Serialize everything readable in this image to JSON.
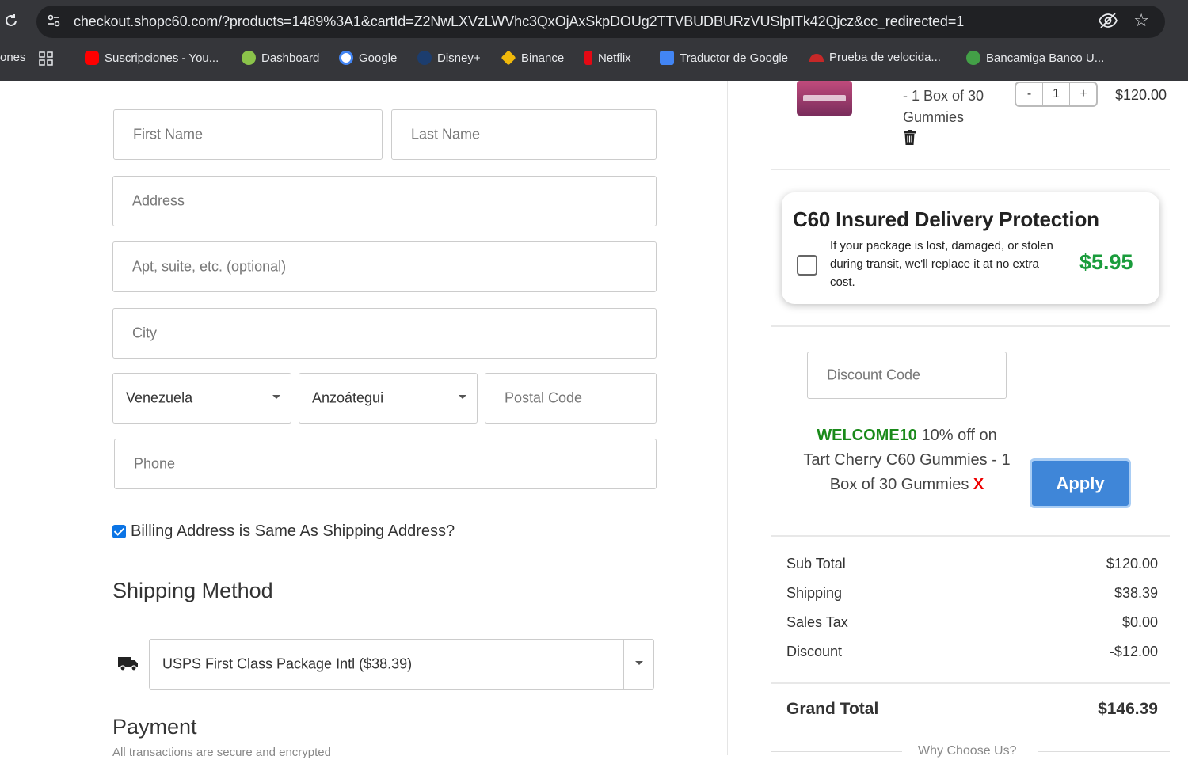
{
  "browser": {
    "url": "checkout.shopc60.com/?products=1489%3A1&cartId=Z2NwLXVzLWVhc3QxOjAxSkpDOUg2TTVBUDBURzVUSlpITk42Qjcz&cc_redirected=1",
    "bookmarks": [
      {
        "label": "ones",
        "icon": "truncated"
      },
      {
        "label": "Suscripciones - You...",
        "icon": "youtube-icon"
      },
      {
        "label": "Dashboard",
        "icon": "dashboard-icon"
      },
      {
        "label": "Google",
        "icon": "google-icon"
      },
      {
        "label": "Disney+",
        "icon": "disney-icon"
      },
      {
        "label": "Binance",
        "icon": "binance-icon"
      },
      {
        "label": "Netflix",
        "icon": "netflix-icon"
      },
      {
        "label": "Traductor de Google",
        "icon": "translate-icon"
      },
      {
        "label": "Prueba de velocida...",
        "icon": "speedtest-icon"
      },
      {
        "label": "Bancamiga Banco U...",
        "icon": "bank-icon"
      }
    ]
  },
  "form": {
    "first_name": "First Name",
    "last_name": "Last Name",
    "address": "Address",
    "apt": "Apt, suite, etc. (optional)",
    "city": "City",
    "country": "Venezuela",
    "state": "Anzoátegui",
    "postal": "Postal Code",
    "phone": "Phone",
    "billing_same": "Billing Address is Same As Shipping Address?",
    "shipping_heading": "Shipping Method",
    "shipping_option": "USPS First Class Package Intl ($38.39)",
    "payment_heading": "Payment",
    "payment_note": "All transactions are secure and encrypted"
  },
  "cart": {
    "item_desc": "- 1 Box of 30 Gummies",
    "qty": "1",
    "minus": "-",
    "plus": "+",
    "price": "$120.00"
  },
  "protection": {
    "title": "C60 Insured Delivery Protection",
    "text": "If your package is lost, damaged, or stolen during transit, we'll replace it at no extra cost.",
    "price": "$5.95"
  },
  "discount": {
    "placeholder": "Discount Code",
    "code": "WELCOME10",
    "description": " 10% off on Tart Cherry C60 Gummies - 1 Box of 30 Gummies ",
    "remove": "X",
    "apply": "Apply"
  },
  "totals": {
    "sub_total_label": "Sub Total",
    "sub_total": "$120.00",
    "shipping_label": "Shipping",
    "shipping": "$38.39",
    "tax_label": "Sales Tax",
    "tax": "$0.00",
    "discount_label": "Discount",
    "discount": "-$12.00",
    "grand_label": "Grand Total",
    "grand": "$146.39"
  },
  "why_choose": "Why Choose Us?"
}
